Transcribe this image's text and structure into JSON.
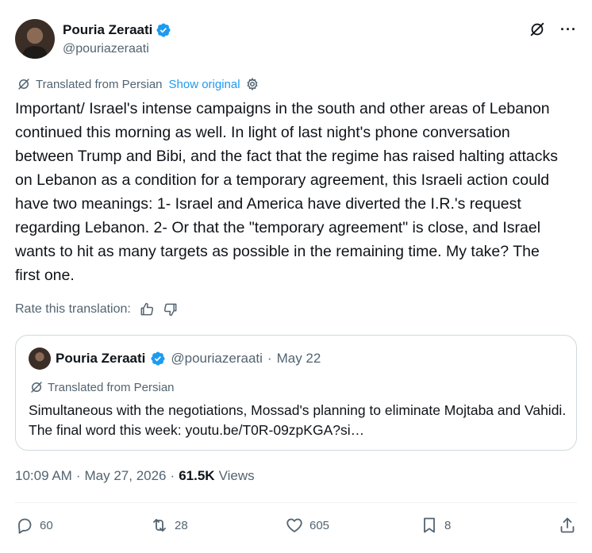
{
  "author": {
    "name": "Pouria Zeraati",
    "handle": "@pouriazeraati"
  },
  "translation": {
    "label": "Translated from Persian",
    "show_original": "Show original"
  },
  "tweet": {
    "text": "Important/ Israel's intense campaigns in the south and other areas of Lebanon continued this morning as well. In light of last night's phone conversation between Trump and Bibi, and the fact that the regime has raised halting attacks on Lebanon as a condition for a temporary agreement, this Israeli action could have two meanings: 1- Israel and America have diverted the I.R.'s request regarding Lebanon. 2- Or that the \"temporary agreement\" is close, and Israel wants to hit as many targets as possible in the remaining time. My take? The first one."
  },
  "rate": {
    "label": "Rate this translation:"
  },
  "quote": {
    "name": "Pouria Zeraati",
    "handle": "@pouriazeraati",
    "separator": "·",
    "date": "May 22",
    "translated_label": "Translated from Persian",
    "text": "Simultaneous with the negotiations,  Mossad's planning to eliminate Mojtaba and Vahidi. The final word this week:  youtu.be/T0R-09zpKGA?si…"
  },
  "meta": {
    "time": "10:09 AM",
    "dot1": "·",
    "date": "May 27, 2026",
    "dot2": "·",
    "views_count": "61.5K",
    "views_label": "Views"
  },
  "actions": {
    "replies": "60",
    "reposts": "28",
    "likes": "605",
    "bookmarks": "8"
  },
  "colors": {
    "accent": "#1d9bf0",
    "text": "#0f1419",
    "secondary": "#536471",
    "border": "#cfd9de"
  }
}
